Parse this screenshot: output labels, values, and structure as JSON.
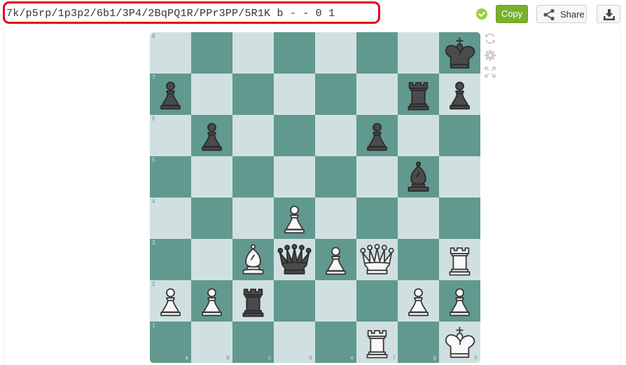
{
  "fen": "7k/p5rp/1p3p2/6b1/3P4/2BqPQ1R/PPr3PP/5R1K b - - 0 1",
  "toolbar": {
    "copy_label": "Copy",
    "share_label": "Share"
  },
  "board": {
    "ranks": [
      "8",
      "7",
      "6",
      "5",
      "4",
      "3",
      "2",
      "1"
    ],
    "files": [
      "a",
      "b",
      "c",
      "d",
      "e",
      "f",
      "g",
      "h"
    ],
    "colors": {
      "light": "#d0e0e0",
      "dark": "#61998f"
    },
    "pieces": [
      {
        "square": "h8",
        "piece": "black-king"
      },
      {
        "square": "a7",
        "piece": "black-pawn"
      },
      {
        "square": "g7",
        "piece": "black-rook"
      },
      {
        "square": "h7",
        "piece": "black-pawn"
      },
      {
        "square": "b6",
        "piece": "black-pawn"
      },
      {
        "square": "f6",
        "piece": "black-pawn"
      },
      {
        "square": "g5",
        "piece": "black-bishop"
      },
      {
        "square": "d4",
        "piece": "white-pawn"
      },
      {
        "square": "c3",
        "piece": "white-bishop"
      },
      {
        "square": "d3",
        "piece": "black-queen"
      },
      {
        "square": "e3",
        "piece": "white-pawn"
      },
      {
        "square": "f3",
        "piece": "white-queen"
      },
      {
        "square": "h3",
        "piece": "white-rook"
      },
      {
        "square": "a2",
        "piece": "white-pawn"
      },
      {
        "square": "b2",
        "piece": "white-pawn"
      },
      {
        "square": "c2",
        "piece": "black-rook"
      },
      {
        "square": "g2",
        "piece": "white-pawn"
      },
      {
        "square": "h2",
        "piece": "white-pawn"
      },
      {
        "square": "f1",
        "piece": "white-rook"
      },
      {
        "square": "h1",
        "piece": "white-king"
      }
    ]
  },
  "side_tools": [
    "rotate-board-icon",
    "settings-gear-icon",
    "fullscreen-icon"
  ]
}
